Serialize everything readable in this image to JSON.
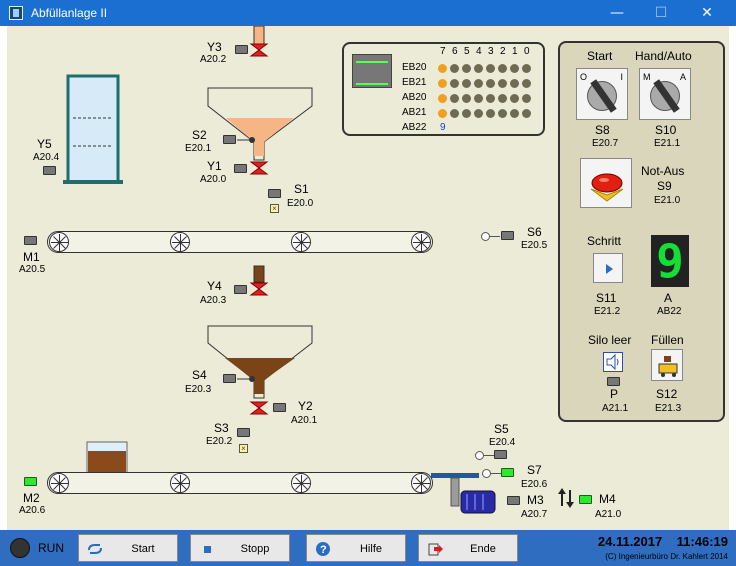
{
  "window": {
    "title": "Abfüllanlage II",
    "minimize": "—",
    "maximize": "☐",
    "close": "✕"
  },
  "colors": {
    "titlebar": "#1a6fd0",
    "panel": "#ecebd8",
    "led_on": "#f0a020",
    "led_off": "#6e6b55",
    "sensor_on": "#2ee82e",
    "segment": "#12e034"
  },
  "process": {
    "Y3": {
      "label": "Y3",
      "addr": "A20.2"
    },
    "S2": {
      "label": "S2",
      "addr": "E20.1"
    },
    "Y1": {
      "label": "Y1",
      "addr": "A20.0"
    },
    "S1": {
      "label": "S1",
      "addr": "E20.0"
    },
    "Y5": {
      "label": "Y5",
      "addr": "A20.4"
    },
    "M1": {
      "label": "M1",
      "addr": "A20.5"
    },
    "S6": {
      "label": "S6",
      "addr": "E20.5"
    },
    "Y4": {
      "label": "Y4",
      "addr": "A20.3"
    },
    "S4": {
      "label": "S4",
      "addr": "E20.3"
    },
    "Y2": {
      "label": "Y2",
      "addr": "A20.1"
    },
    "S3": {
      "label": "S3",
      "addr": "E20.2"
    },
    "S5": {
      "label": "S5",
      "addr": "E20.4"
    },
    "S7": {
      "label": "S7",
      "addr": "E20.6"
    },
    "M2": {
      "label": "M2",
      "addr": "A20.6"
    },
    "M3": {
      "label": "M3",
      "addr": "A20.7"
    },
    "M4": {
      "label": "M4",
      "addr": "A21.0"
    }
  },
  "io": {
    "bits": [
      "7",
      "6",
      "5",
      "4",
      "3",
      "2",
      "1",
      "0"
    ],
    "rows": [
      {
        "name": "EB20",
        "bits": [
          1,
          0,
          0,
          0,
          0,
          0,
          0,
          0
        ]
      },
      {
        "name": "EB21",
        "bits": [
          1,
          0,
          0,
          0,
          0,
          0,
          0,
          0
        ]
      },
      {
        "name": "AB20",
        "bits": [
          1,
          0,
          0,
          0,
          0,
          0,
          0,
          0
        ]
      },
      {
        "name": "AB21",
        "bits": [
          1,
          0,
          0,
          0,
          0,
          0,
          0,
          0
        ]
      }
    ],
    "ab22_name": "AB22",
    "ab22_value": "9"
  },
  "controls": {
    "start": {
      "title": "Start",
      "label": "S8",
      "addr": "E20.7",
      "pos0": "O",
      "pos1": "I"
    },
    "hand_auto": {
      "title": "Hand/Auto",
      "label": "S10",
      "addr": "E21.1",
      "pos0": "M",
      "pos1": "A"
    },
    "not_aus": {
      "title": "Not-Aus",
      "label": "S9",
      "addr": "E21.0"
    },
    "schritt": {
      "title": "Schritt",
      "label": "S11",
      "addr": "E21.2"
    },
    "display": {
      "label": "A",
      "addr": "AB22",
      "digit": "9"
    },
    "silo_leer": {
      "title": "Silo leer",
      "label": "P",
      "addr": "A21.1"
    },
    "fuellen": {
      "title": "Füllen",
      "label": "S12",
      "addr": "E21.3"
    }
  },
  "taskbar": {
    "run": "RUN",
    "start": "Start",
    "stopp": "Stopp",
    "hilfe": "Hilfe",
    "ende": "Ende",
    "datetime": "24.11.2017    11:46:19",
    "copyright": "(C) Ingenieurbüro Dr. Kahlert 2014"
  }
}
